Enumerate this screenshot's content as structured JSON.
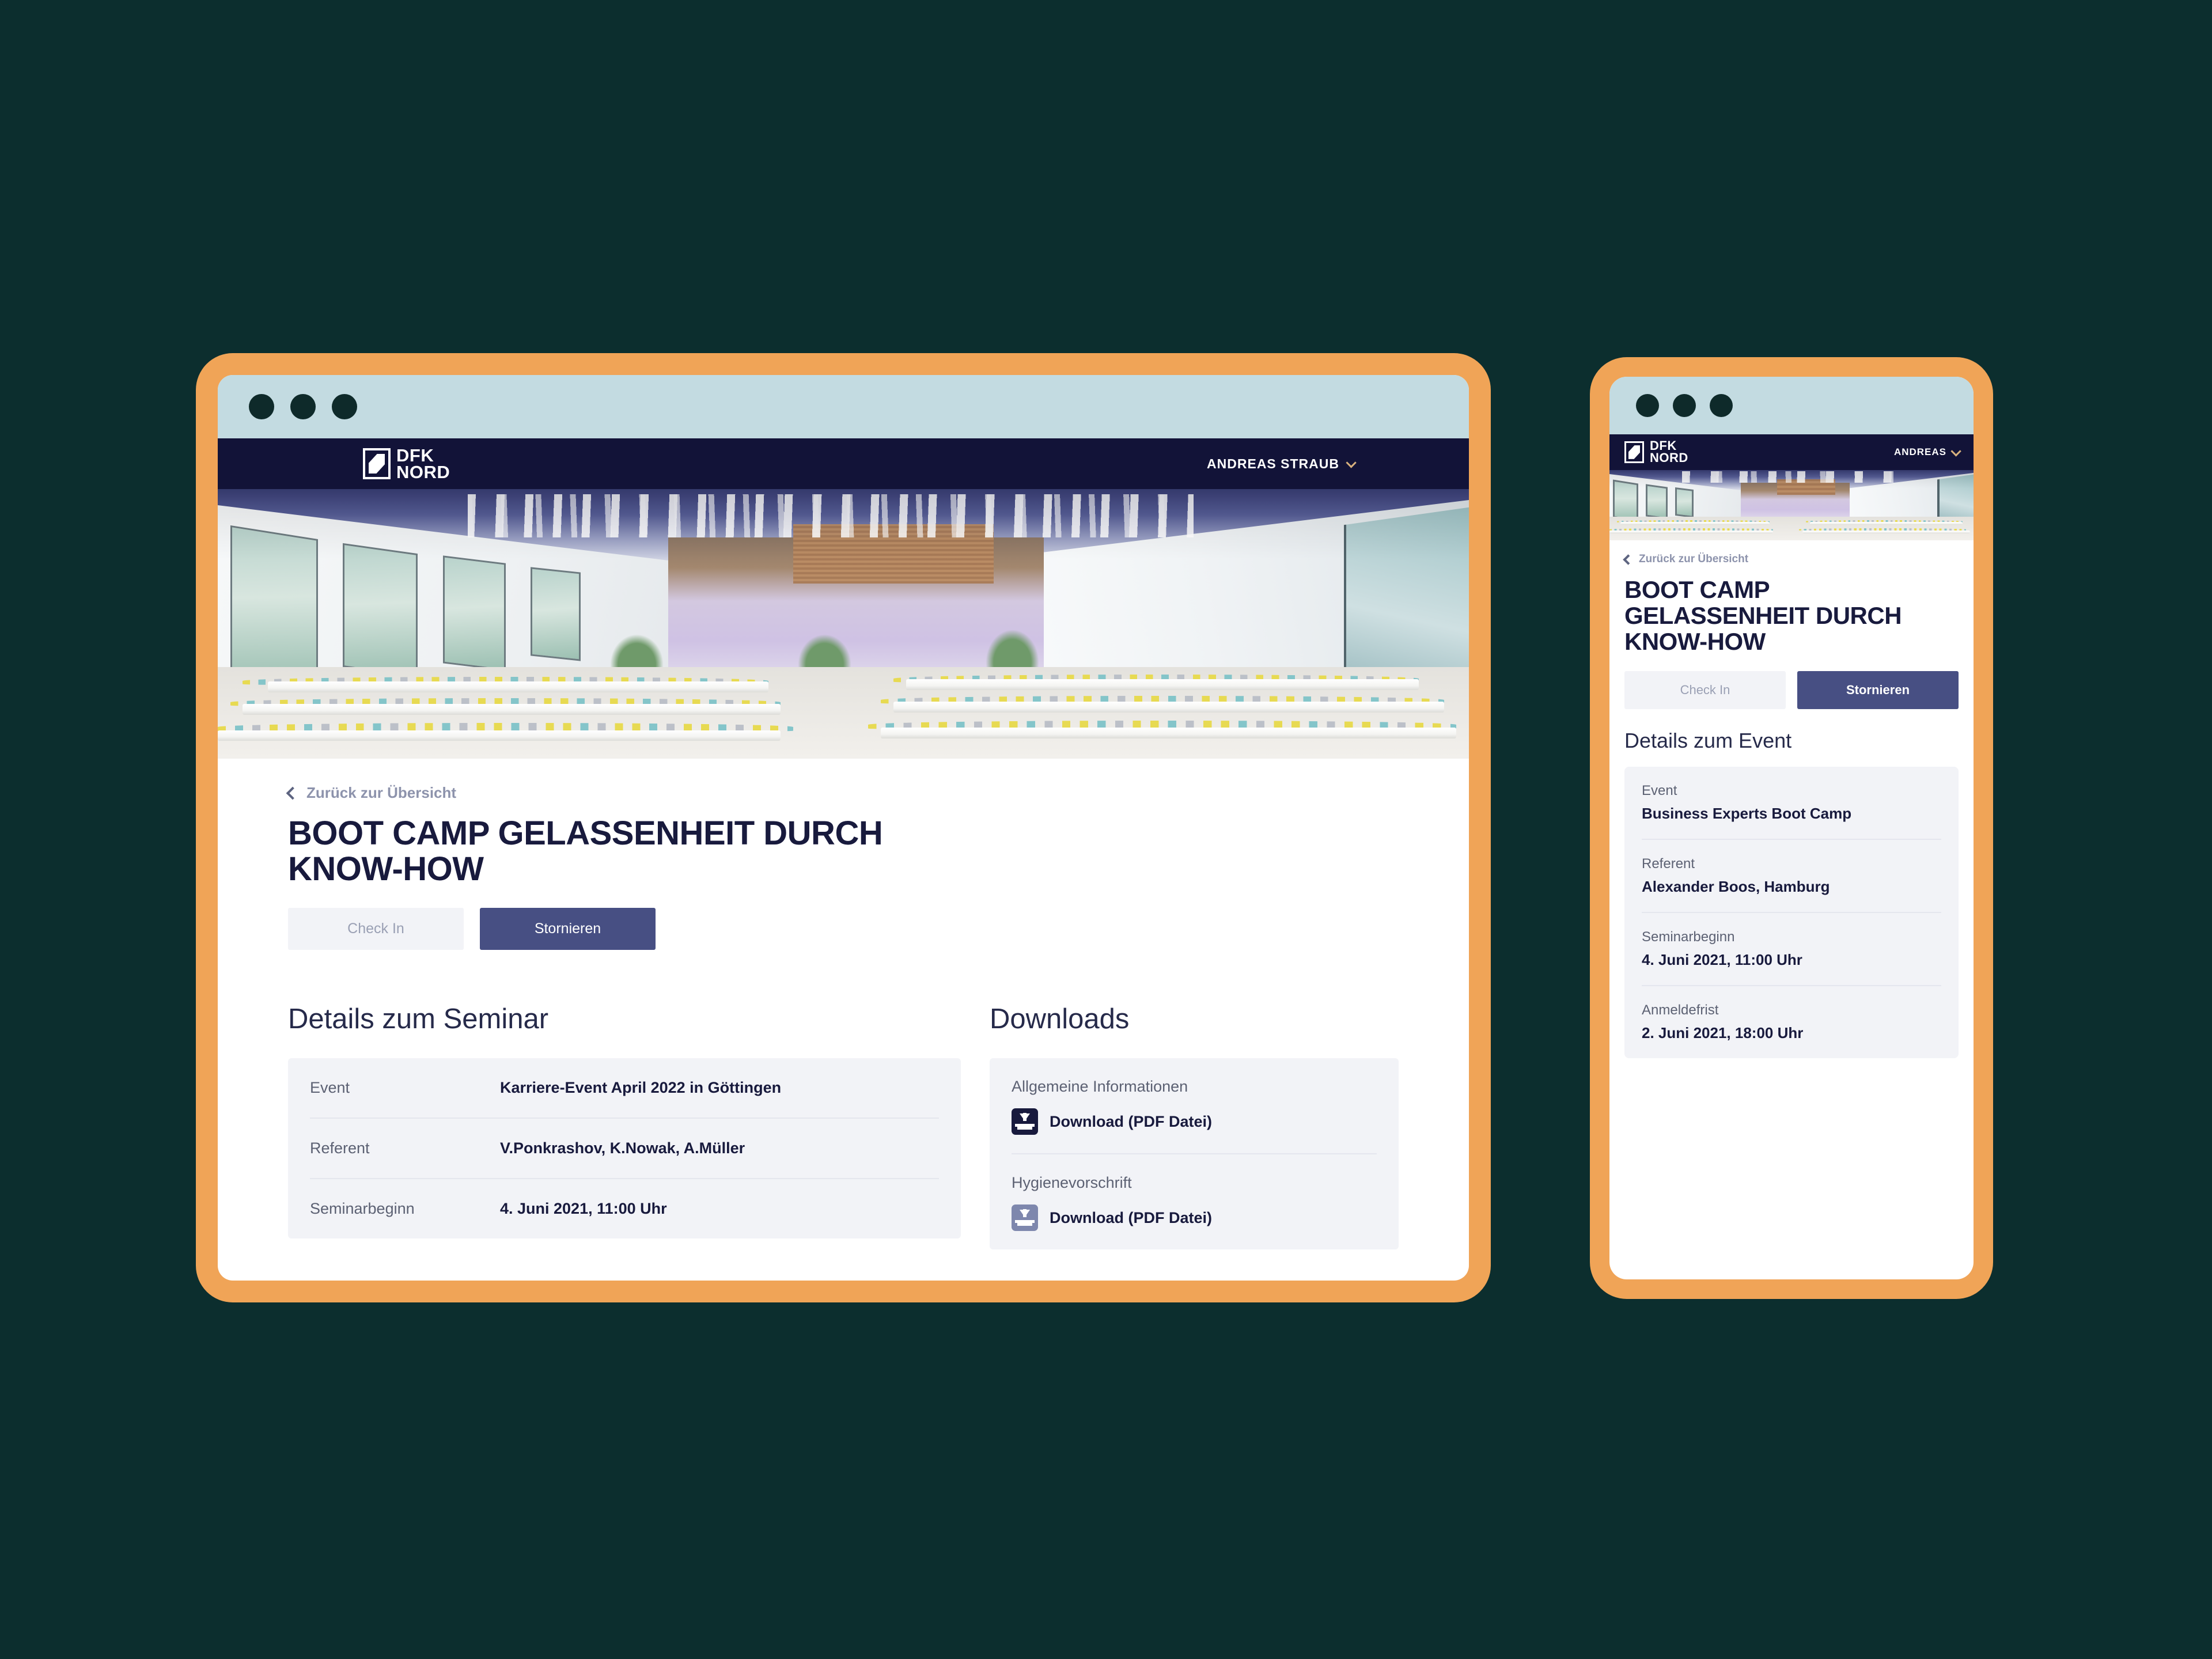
{
  "theme": {
    "page_background": "#0c2e2e",
    "frame_orange": "#f0a457",
    "titlebar": "#c3dbe1",
    "header_navy": "#121338",
    "primary_button": "#474f83",
    "secondary_button": "#f2f3f7",
    "panel_background": "#f2f3f7",
    "heading_navy": "#181a3d",
    "muted_text": "#5c6173"
  },
  "desktop": {
    "titlebar": {
      "dots": [
        "window-dot",
        "window-dot",
        "window-dot"
      ]
    },
    "header": {
      "logo_line1": "DFK",
      "logo_line2": "NORD",
      "user_name": "ANDREAS STRAUB",
      "chevron": "chevron-down-icon"
    },
    "hero": {
      "alt": "Seminar hall with rows of white tables and colourful chairs"
    },
    "back_link": "Zurück zur Übersicht",
    "page_title": "BOOT CAMP GELASSENHEIT DURCH KNOW-HOW",
    "buttons": {
      "check_in": "Check In",
      "cancel": "Stornieren"
    },
    "details": {
      "title": "Details zum Seminar",
      "rows": [
        {
          "label": "Event",
          "value": "Karriere-Event April 2022 in Göttingen"
        },
        {
          "label": "Referent",
          "value": "V.Ponkrashov, K.Nowak,  A.Müller"
        },
        {
          "label": "Seminarbeginn",
          "value": "4. Juni 2021, 11:00 Uhr"
        }
      ]
    },
    "downloads": {
      "title": "Downloads",
      "groups": [
        {
          "caption": "Allgemeine Informationen",
          "link": "Download (PDF Datei)"
        },
        {
          "caption": "Hygienevorschrift",
          "link": "Download (PDF Datei)"
        }
      ]
    }
  },
  "mobile": {
    "titlebar": {
      "dots": [
        "window-dot",
        "window-dot",
        "window-dot"
      ]
    },
    "header": {
      "logo_line1": "DFK",
      "logo_line2": "NORD",
      "user_name": "ANDREAS",
      "chevron": "chevron-down-icon"
    },
    "back_link": "Zurück zur Übersicht",
    "page_title": "BOOT CAMP GELASSENHEIT DURCH KNOW-HOW",
    "buttons": {
      "check_in": "Check In",
      "cancel": "Stornieren"
    },
    "details": {
      "title": "Details zum Event",
      "rows": [
        {
          "label": "Event",
          "value": "Business Experts Boot Camp"
        },
        {
          "label": "Referent",
          "value": "Alexander Boos, Hamburg"
        },
        {
          "label": "Seminarbeginn",
          "value": "4. Juni 2021, 11:00 Uhr"
        },
        {
          "label": "Anmeldefrist",
          "value": "2. Juni 2021, 18:00 Uhr"
        }
      ]
    }
  }
}
